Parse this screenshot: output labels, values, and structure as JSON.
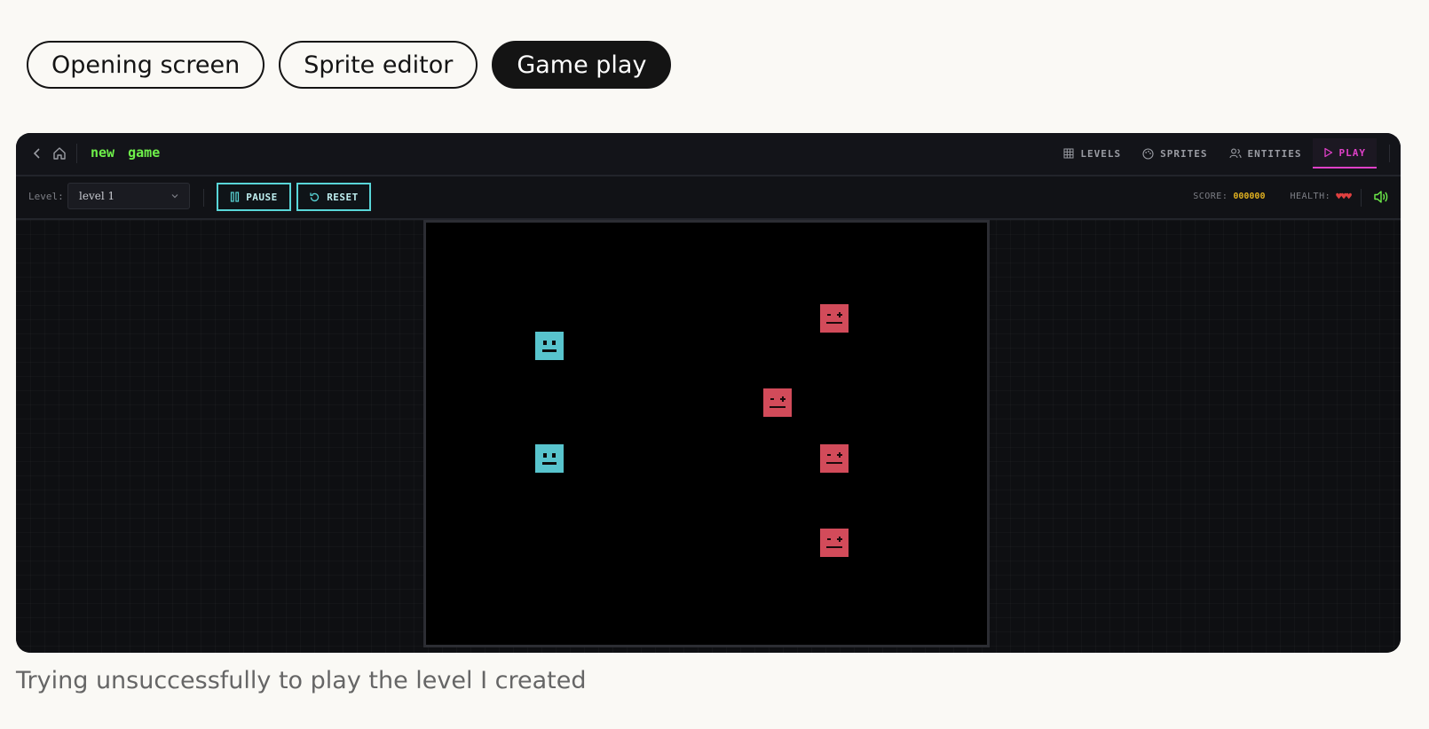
{
  "tabs": [
    {
      "label": "Opening screen",
      "active": false
    },
    {
      "label": "Sprite editor",
      "active": false
    },
    {
      "label": "Game play",
      "active": true
    }
  ],
  "app": {
    "title": "new game",
    "nav": [
      {
        "label": "LEVELS",
        "icon": "grid-icon",
        "active": false
      },
      {
        "label": "SPRITES",
        "icon": "palette-icon",
        "active": false
      },
      {
        "label": "ENTITIES",
        "icon": "users-icon",
        "active": false
      },
      {
        "label": "PLAY",
        "icon": "play-icon",
        "active": true
      }
    ],
    "accent_color": "#e040c8"
  },
  "toolbar": {
    "level_label": "Level:",
    "level_value": "level 1",
    "pause_label": "PAUSE",
    "reset_label": "RESET",
    "score_label": "SCORE:",
    "score_value": "000000",
    "health_label": "HEALTH:",
    "health_value": "♥♥♥",
    "button_color": "#59d6d8"
  },
  "game": {
    "player_color": "#58c4cd",
    "enemy_color": "#d24b5a"
  },
  "caption": "Trying unsuccessfully to play the level I created"
}
